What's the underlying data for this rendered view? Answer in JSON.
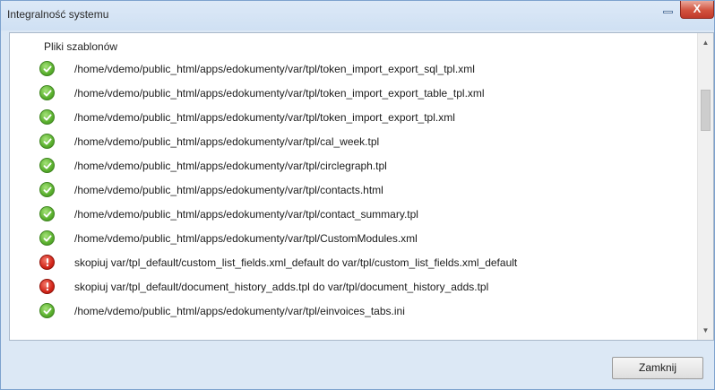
{
  "window": {
    "title": "Integralność systemu",
    "close_glyph": "X",
    "minimize_icon": "minimize-icon"
  },
  "section": {
    "title": "Pliki szablonów"
  },
  "items": [
    {
      "status": "ok",
      "icon": "check-icon",
      "text": "/home/vdemo/public_html/apps/edokumenty/var/tpl/token_import_export_sql_tpl.xml"
    },
    {
      "status": "ok",
      "icon": "check-icon",
      "text": "/home/vdemo/public_html/apps/edokumenty/var/tpl/token_import_export_table_tpl.xml"
    },
    {
      "status": "ok",
      "icon": "check-icon",
      "text": "/home/vdemo/public_html/apps/edokumenty/var/tpl/token_import_export_tpl.xml"
    },
    {
      "status": "ok",
      "icon": "check-icon",
      "text": "/home/vdemo/public_html/apps/edokumenty/var/tpl/cal_week.tpl"
    },
    {
      "status": "ok",
      "icon": "check-icon",
      "text": "/home/vdemo/public_html/apps/edokumenty/var/tpl/circlegraph.tpl"
    },
    {
      "status": "ok",
      "icon": "check-icon",
      "text": "/home/vdemo/public_html/apps/edokumenty/var/tpl/contacts.html"
    },
    {
      "status": "ok",
      "icon": "check-icon",
      "text": "/home/vdemo/public_html/apps/edokumenty/var/tpl/contact_summary.tpl"
    },
    {
      "status": "ok",
      "icon": "check-icon",
      "text": "/home/vdemo/public_html/apps/edokumenty/var/tpl/CustomModules.xml"
    },
    {
      "status": "error",
      "icon": "exclamation-icon",
      "text": "skopiuj var/tpl_default/custom_list_fields.xml_default do var/tpl/custom_list_fields.xml_default"
    },
    {
      "status": "error",
      "icon": "exclamation-icon",
      "text": "skopiuj var/tpl_default/document_history_adds.tpl do var/tpl/document_history_adds.tpl"
    },
    {
      "status": "ok",
      "icon": "check-icon",
      "text": "/home/vdemo/public_html/apps/edokumenty/var/tpl/einvoices_tabs.ini"
    }
  ],
  "footer": {
    "close_button_label": "Zamknij"
  },
  "colors": {
    "ok": "#5ab02e",
    "error": "#d3261a",
    "title_bar": "#dde9f7",
    "close_button": "#c0392b"
  }
}
